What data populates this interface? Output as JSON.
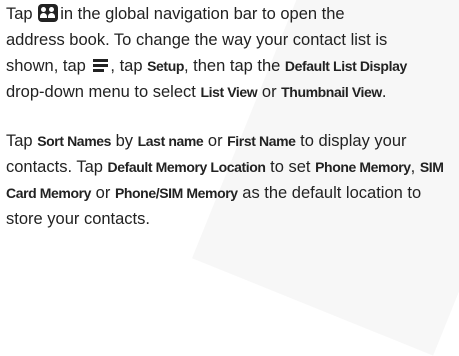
{
  "paragraph1": {
    "l1_a": "Tap",
    "l1_b": "in the global navigation bar to open the",
    "l2": "address book. To change the way your contact list is",
    "l3_a": "shown, tap",
    "l3_b": ", tap",
    "l3_setup": "Setup",
    "l3_c": ", then tap the",
    "l3_default_list_display": "Default List Display",
    "l4_a": "drop-down menu to select",
    "l4_list_view": "List View",
    "l4_b": "or",
    "l4_thumbnail_view": "Thumbnail View",
    "l4_c": "."
  },
  "paragraph2": {
    "l1_a": "Tap",
    "l1_sort_names": "Sort Names",
    "l1_b": "by",
    "l1_last_name": "Last name",
    "l1_c": "or",
    "l1_first_name": "First Name",
    "l1_d": "to display your",
    "l2_a": "contacts. Tap",
    "l2_default_memory_location": "Default Memory Location",
    "l2_b": "to set",
    "l2_phone_memory": "Phone Memory",
    "l2_c": ",",
    "l2_sim": "SIM",
    "l3_card_memory": "Card Memory",
    "l3_a": "or",
    "l3_phone_sim_memory": "Phone/SIM Memory",
    "l3_b": "as the default location to",
    "l4": "store your contacts."
  },
  "icons": {
    "contacts": "contacts-icon",
    "menu": "menu-icon"
  }
}
